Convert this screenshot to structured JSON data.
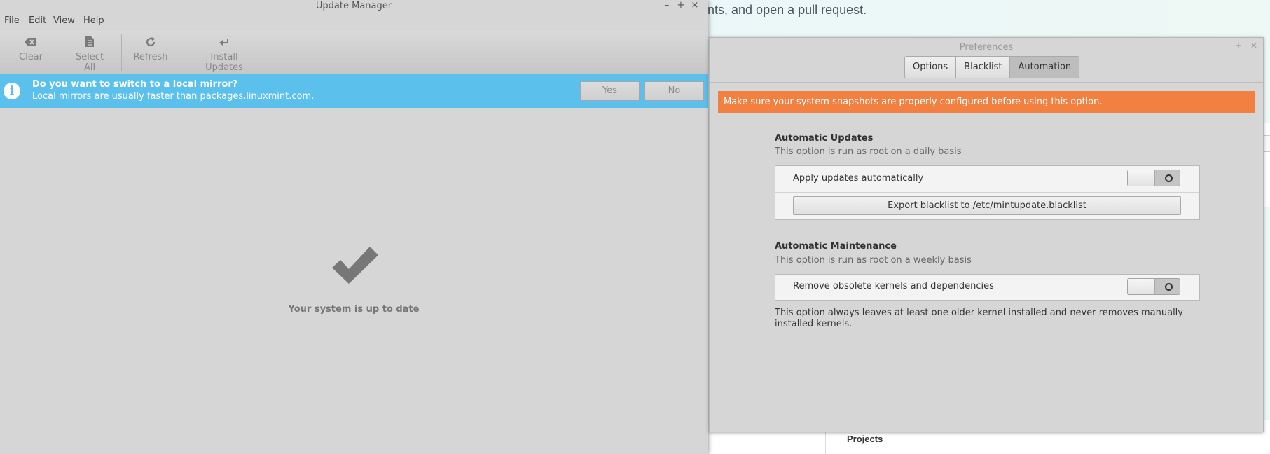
{
  "background": {
    "text": "ents, and open a pull request.",
    "projects_label": "Projects"
  },
  "update_manager": {
    "title": "Update Manager",
    "window_buttons": [
      "–",
      "+",
      "×"
    ],
    "menu": [
      "File",
      "Edit",
      "View",
      "Help"
    ],
    "toolbar": {
      "clear": "Clear",
      "select_all": "Select All",
      "refresh": "Refresh",
      "install_updates": "Install Updates"
    },
    "infobar": {
      "title": "Do you want to switch to a local mirror?",
      "subtitle": "Local mirrors are usually faster than packages.linuxmint.com.",
      "yes": "Yes",
      "no": "No",
      "color": "#5bc0eb"
    },
    "status": "Your system is up to date"
  },
  "preferences": {
    "title": "Preferences",
    "window_buttons": [
      "–",
      "+",
      "×"
    ],
    "tabs": [
      "Options",
      "Blacklist",
      "Automation"
    ],
    "active_tab": "Automation",
    "warning": "Make sure your system snapshots are properly configured before using this option.",
    "warning_color": "#f28041",
    "automatic_updates": {
      "title": "Automatic Updates",
      "subtitle": "This option is run as root on a daily basis",
      "apply_label": "Apply updates automatically",
      "apply_enabled": false,
      "export_button": "Export blacklist to /etc/mintupdate.blacklist"
    },
    "automatic_maintenance": {
      "title": "Automatic Maintenance",
      "subtitle": "This option is run as root on a weekly basis",
      "remove_label": "Remove obsolete kernels and dependencies",
      "remove_enabled": false
    },
    "note": "This option always leaves at least one older kernel installed and never removes manually installed kernels."
  }
}
